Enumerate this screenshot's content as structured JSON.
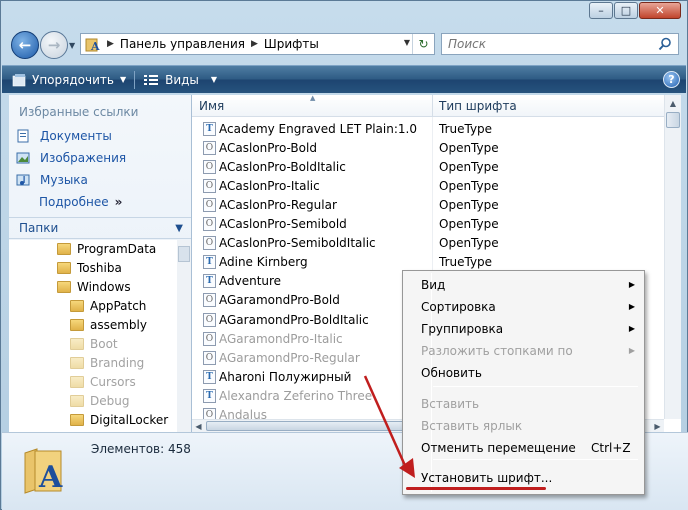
{
  "window": {
    "buttons": {
      "minimize": "–",
      "maximize": "□",
      "close": "✕"
    }
  },
  "address": {
    "crumbs": [
      "Панель управления",
      "Шрифты"
    ],
    "search_placeholder": "Поиск"
  },
  "toolbar": {
    "organize_label": "Упорядочить",
    "views_label": "Виды"
  },
  "sidebar": {
    "favorites_title": "Избранные ссылки",
    "favorites": [
      {
        "label": "Документы",
        "icon": "documents-icon"
      },
      {
        "label": "Изображения",
        "icon": "pictures-icon"
      },
      {
        "label": "Музыка",
        "icon": "music-icon"
      }
    ],
    "more_label": "Подробнее",
    "more_chevron": "»",
    "folders_label": "Папки",
    "tree": [
      {
        "label": "ProgramData",
        "dim": false
      },
      {
        "label": "Toshiba",
        "dim": false
      },
      {
        "label": "Windows",
        "dim": false
      },
      {
        "label": "AppPatch",
        "dim": false
      },
      {
        "label": "assembly",
        "dim": false
      },
      {
        "label": "Boot",
        "dim": true
      },
      {
        "label": "Branding",
        "dim": true
      },
      {
        "label": "Cursors",
        "dim": true
      },
      {
        "label": "Debug",
        "dim": true
      },
      {
        "label": "DigitalLocker",
        "dim": false
      }
    ]
  },
  "filelist": {
    "col_name": "Имя",
    "col_type": "Тип шрифта",
    "rows": [
      {
        "name": "Academy Engraved LET Plain:1.0",
        "type": "TrueType",
        "kind": "tt",
        "dim": false
      },
      {
        "name": "ACaslonPro-Bold",
        "type": "OpenType",
        "kind": "ot",
        "dim": false
      },
      {
        "name": "ACaslonPro-BoldItalic",
        "type": "OpenType",
        "kind": "ot",
        "dim": false
      },
      {
        "name": "ACaslonPro-Italic",
        "type": "OpenType",
        "kind": "ot",
        "dim": false
      },
      {
        "name": "ACaslonPro-Regular",
        "type": "OpenType",
        "kind": "ot",
        "dim": false
      },
      {
        "name": "ACaslonPro-Semibold",
        "type": "OpenType",
        "kind": "ot",
        "dim": false
      },
      {
        "name": "ACaslonPro-SemiboldItalic",
        "type": "OpenType",
        "kind": "ot",
        "dim": false
      },
      {
        "name": "Adine Kirnberg",
        "type": "TrueType",
        "kind": "tt",
        "dim": false
      },
      {
        "name": "Adventure",
        "type": "",
        "kind": "tt",
        "dim": false
      },
      {
        "name": "AGaramondPro-Bold",
        "type": "",
        "kind": "ot",
        "dim": false
      },
      {
        "name": "AGaramondPro-BoldItalic",
        "type": "",
        "kind": "ot",
        "dim": false
      },
      {
        "name": "AGaramondPro-Italic",
        "type": "",
        "kind": "ot",
        "dim": true
      },
      {
        "name": "AGaramondPro-Regular",
        "type": "",
        "kind": "ot",
        "dim": true
      },
      {
        "name": "Aharoni Полужирный",
        "type": "",
        "kind": "tt",
        "dim": false
      },
      {
        "name": "Alexandra Zeferino Three",
        "type": "",
        "kind": "tt",
        "dim": true
      },
      {
        "name": "Andalus",
        "type": "",
        "kind": "ot",
        "dim": true
      }
    ]
  },
  "details": {
    "count_label": "Элементов: 458"
  },
  "context_menu": {
    "items": [
      {
        "label": "Вид",
        "submenu": true,
        "disabled": false,
        "shortcut": ""
      },
      {
        "label": "Сортировка",
        "submenu": true,
        "disabled": false,
        "shortcut": ""
      },
      {
        "label": "Группировка",
        "submenu": true,
        "disabled": false,
        "shortcut": ""
      },
      {
        "label": "Разложить стопками по",
        "submenu": true,
        "disabled": true,
        "shortcut": ""
      },
      {
        "label": "Обновить",
        "submenu": false,
        "disabled": false,
        "shortcut": ""
      },
      {
        "label": "Вставить",
        "submenu": false,
        "disabled": true,
        "shortcut": ""
      },
      {
        "label": "Вставить ярлык",
        "submenu": false,
        "disabled": true,
        "shortcut": ""
      },
      {
        "label": "Отменить перемещение",
        "submenu": false,
        "disabled": false,
        "shortcut": "Ctrl+Z"
      },
      {
        "label": "Установить шрифт...",
        "submenu": false,
        "disabled": false,
        "shortcut": ""
      }
    ]
  },
  "colors": {
    "toolbar": "#26537d",
    "link": "#1e56a6",
    "annotation_arrow": "#c01e1e"
  }
}
